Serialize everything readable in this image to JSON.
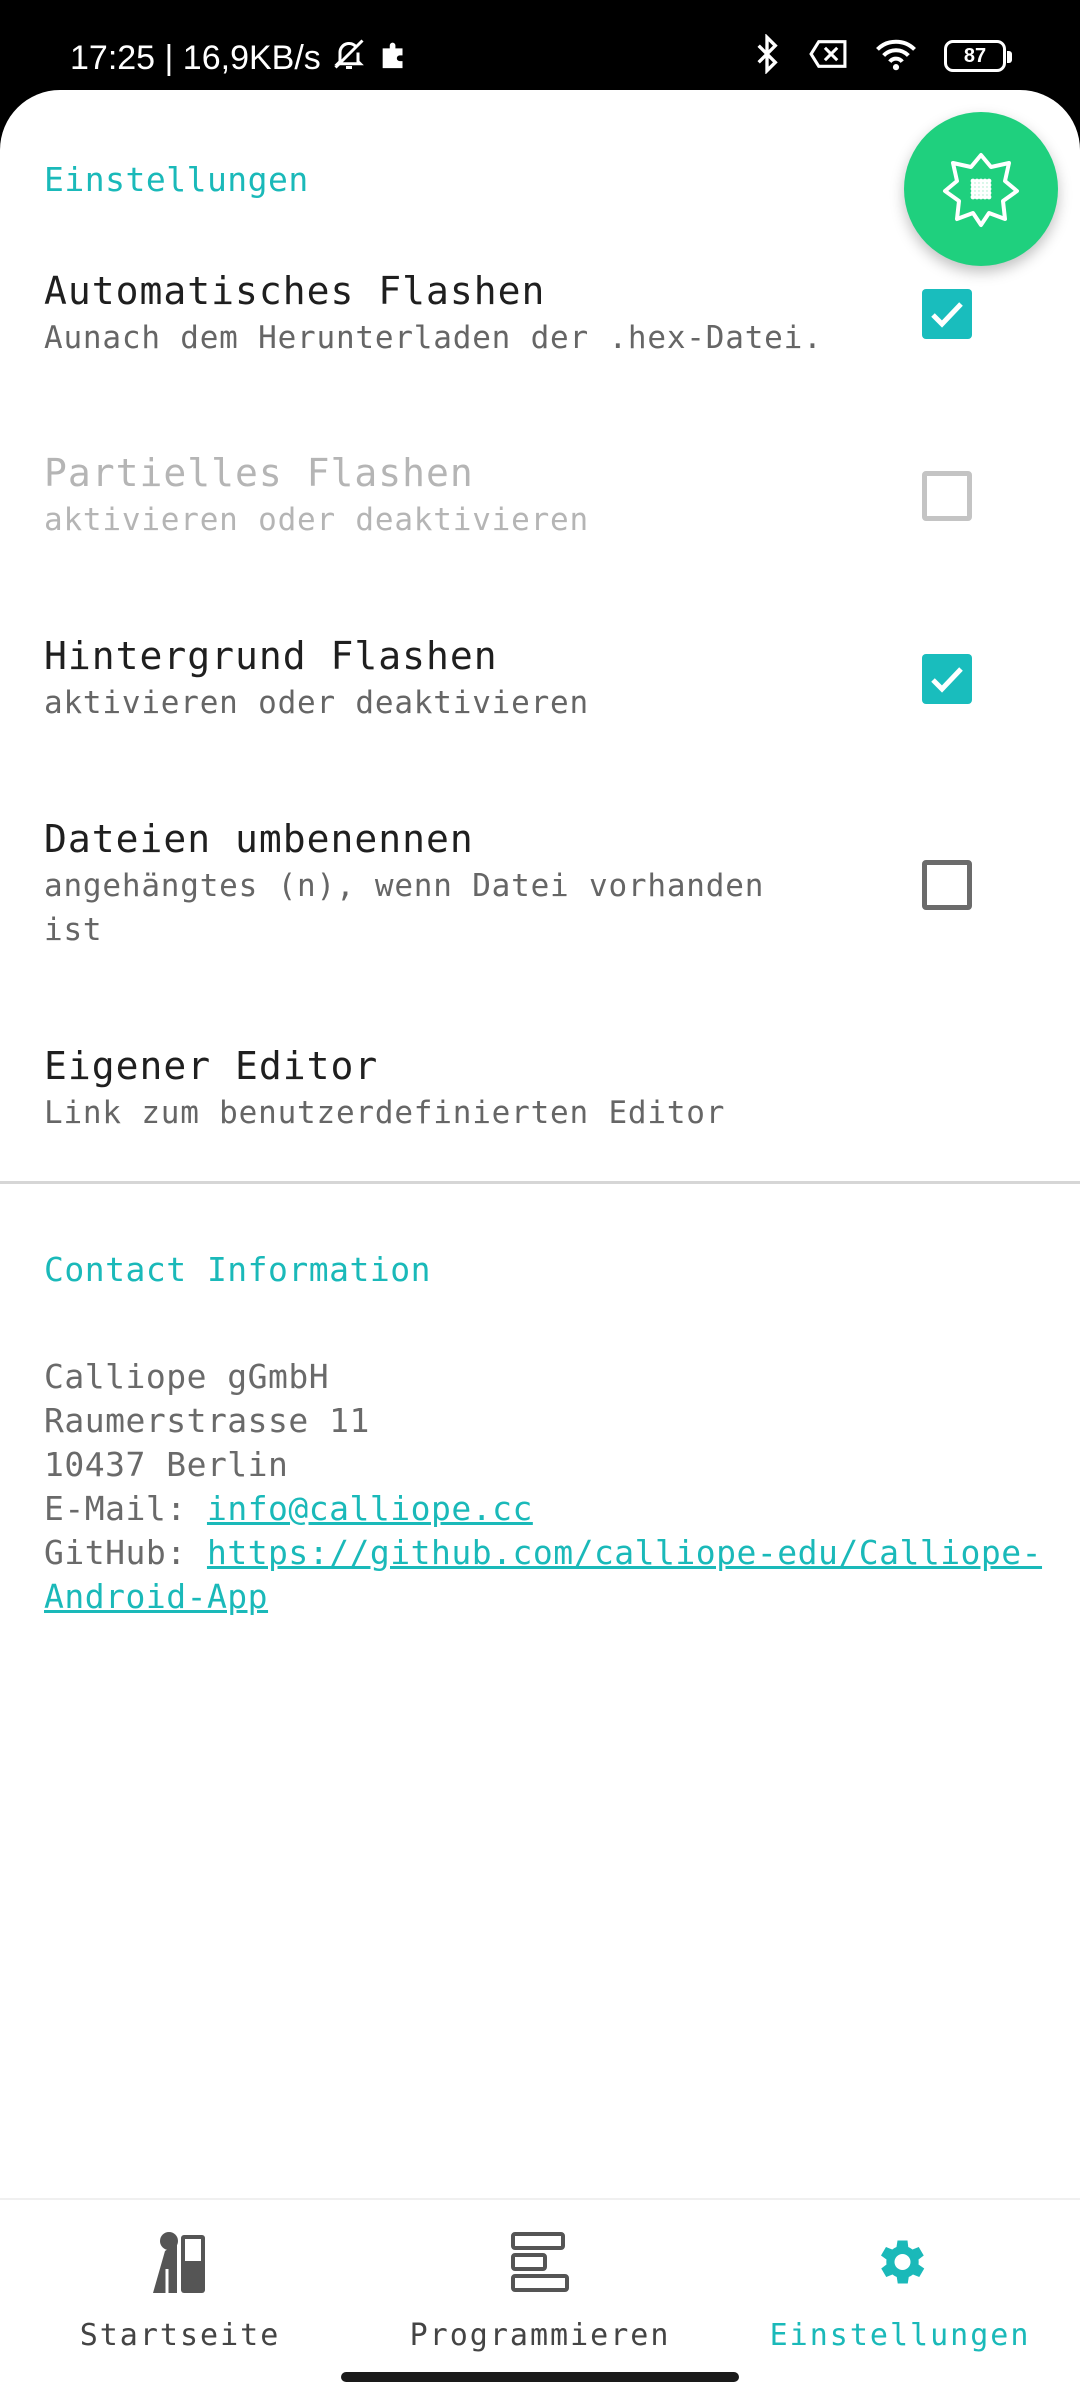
{
  "status_bar": {
    "time_speed": "17:25 | 16,9KB/s",
    "battery": "87"
  },
  "settings": {
    "header": "Einstellungen",
    "items": [
      {
        "title": "Automatisches Flashen",
        "summary": "Aunach dem Herunterladen der .hex-Datei.",
        "checked": true,
        "enabled": true
      },
      {
        "title": "Partielles Flashen",
        "summary": "aktivieren oder deaktivieren",
        "checked": false,
        "enabled": false
      },
      {
        "title": "Hintergrund Flashen",
        "summary": "aktivieren oder deaktivieren",
        "checked": true,
        "enabled": true
      },
      {
        "title": "Dateien umbenennen",
        "summary": "angehängtes (n), wenn Datei vorhanden ist",
        "checked": false,
        "enabled": true
      },
      {
        "title": "Eigener Editor",
        "summary": "Link zum benutzerdefinierten Editor"
      }
    ]
  },
  "contact": {
    "header": "Contact Information",
    "company": "Calliope gGmbH",
    "street": "Raumerstrasse 11",
    "city": "10437 Berlin",
    "email_label": "E-Mail: ",
    "email": "info@calliope.cc",
    "github_label": "GitHub: ",
    "github_url": "https://github.com/calliope-edu/Calliope-Android-App"
  },
  "bottom_nav": {
    "items": [
      {
        "label": "Startseite",
        "icon": "home-icon",
        "active": false
      },
      {
        "label": "Programmieren",
        "icon": "code-blocks-icon",
        "active": false
      },
      {
        "label": "Einstellungen",
        "icon": "settings-icon",
        "active": true
      }
    ]
  },
  "colors": {
    "accent": "#1ab9b9",
    "fab": "#1fd07e",
    "checkbox_checked": "#19bdbd"
  }
}
